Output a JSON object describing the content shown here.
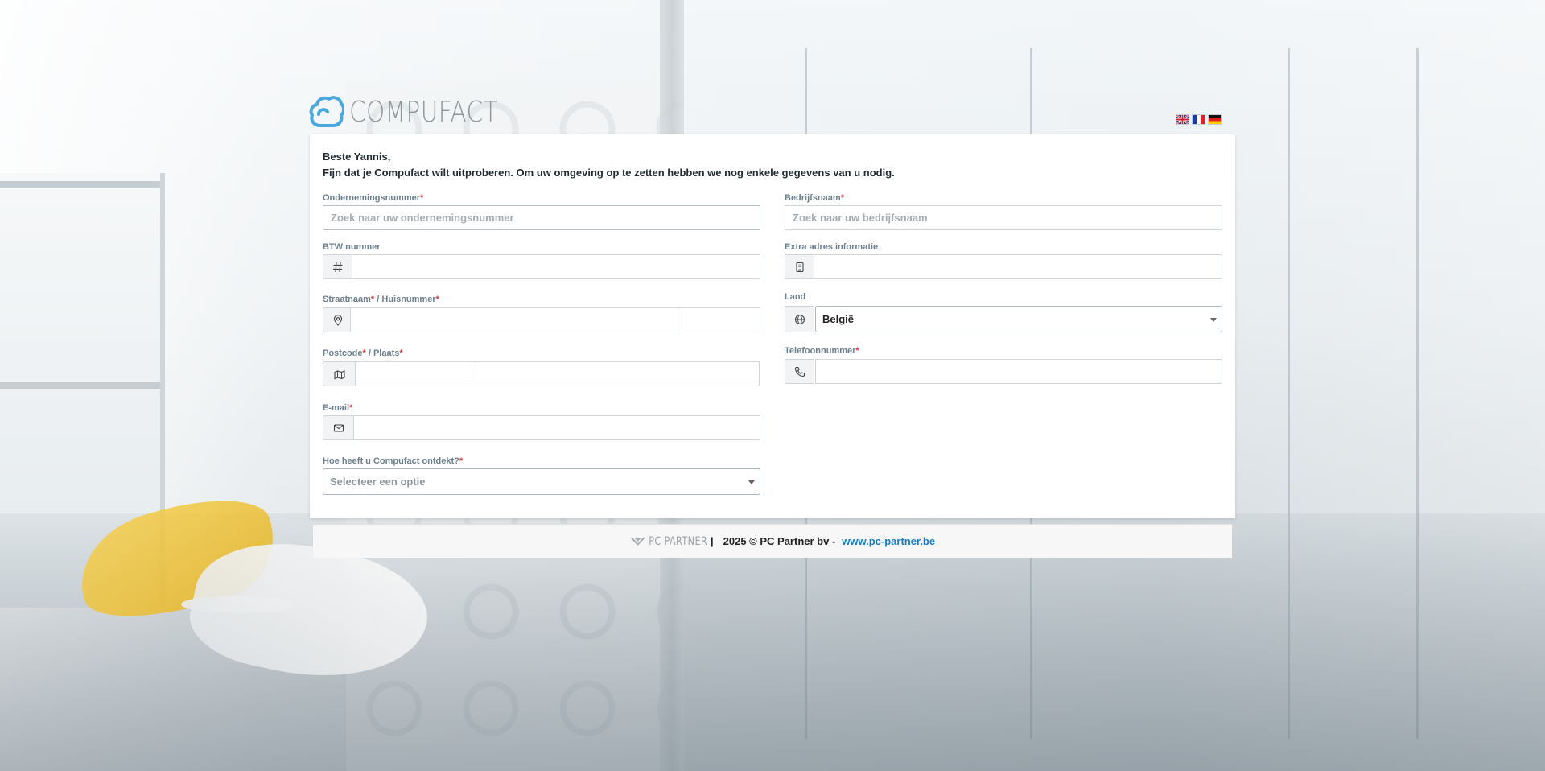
{
  "header": {
    "logo_text": "COMPUFACT",
    "languages": [
      {
        "code": "en",
        "icon": "flag-uk-icon"
      },
      {
        "code": "fr",
        "icon": "flag-fr-icon"
      },
      {
        "code": "de",
        "icon": "flag-de-icon"
      }
    ]
  },
  "greeting": {
    "line1": "Beste Yannis,",
    "line2": "Fijn dat je Compufact wilt uitproberen. Om uw omgeving op te zetten hebben we nog enkele gegevens van u nodig."
  },
  "form": {
    "company_number": {
      "label": "Ondernemingsnummer",
      "placeholder": "Zoek naar uw ondernemingsnummer",
      "value": ""
    },
    "company_name": {
      "label": "Bedrijfsnaam",
      "placeholder": "Zoek naar uw bedrijfsnaam",
      "value": ""
    },
    "vat": {
      "label": "BTW nummer",
      "value": "",
      "icon": "hash-icon"
    },
    "extra_address": {
      "label": "Extra adres informatie",
      "value": "",
      "icon": "building-icon"
    },
    "street": {
      "label": "Straatnaam",
      "separator": " / ",
      "label2": "Huisnummer",
      "value": "",
      "number_value": "",
      "icon": "map-pin-icon"
    },
    "country": {
      "label": "Land",
      "value": "België",
      "icon": "globe-icon"
    },
    "postcode": {
      "label": "Postcode",
      "separator": " / ",
      "label2": "Plaats",
      "value": "",
      "city_value": "",
      "icon": "map-icon"
    },
    "phone": {
      "label": "Telefoonnummer",
      "value": "",
      "icon": "phone-icon"
    },
    "email": {
      "label": "E-mail",
      "value": "",
      "icon": "envelope-icon"
    },
    "discovery": {
      "label": "Hoe heeft u Compufact ontdekt?",
      "placeholder": "Selecteer een optie"
    },
    "required_marker": "*"
  },
  "footer": {
    "partner_logo": "PC PARTNER",
    "divider": "|",
    "copyright": "2025 © PC Partner bv -",
    "link": "www.pc-partner.be"
  },
  "colors": {
    "label": "#6b7f8c",
    "required": "#d9363e",
    "link": "#1a7cc4",
    "logo": "#4aa8de"
  }
}
